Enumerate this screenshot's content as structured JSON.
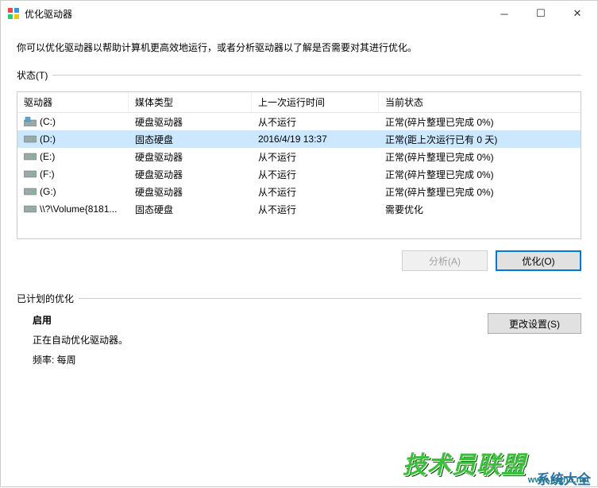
{
  "titlebar": {
    "title": "优化驱动器"
  },
  "description": "你可以优化驱动器以帮助计算机更高效地运行，或者分析驱动器以了解是否需要对其进行优化。",
  "status_label": "状态(T)",
  "table": {
    "headers": {
      "drive": "驱动器",
      "media": "媒体类型",
      "last": "上一次运行时间",
      "status": "当前状态"
    },
    "rows": [
      {
        "icon": "os",
        "name": "(C:)",
        "media": "硬盘驱动器",
        "last": "从不运行",
        "status": "正常(碎片整理已完成 0%)"
      },
      {
        "icon": "hdd",
        "name": "(D:)",
        "media": "固态硬盘",
        "last": "2016/4/19 13:37",
        "status": "正常(距上次运行已有 0 天)",
        "selected": true
      },
      {
        "icon": "hdd",
        "name": "(E:)",
        "media": "硬盘驱动器",
        "last": "从不运行",
        "status": "正常(碎片整理已完成 0%)"
      },
      {
        "icon": "hdd",
        "name": "(F:)",
        "media": "硬盘驱动器",
        "last": "从不运行",
        "status": "正常(碎片整理已完成 0%)"
      },
      {
        "icon": "hdd",
        "name": "(G:)",
        "media": "硬盘驱动器",
        "last": "从不运行",
        "status": "正常(碎片整理已完成 0%)"
      },
      {
        "icon": "hdd",
        "name": "\\\\?\\Volume{8181...",
        "media": "固态硬盘",
        "last": "从不运行",
        "status": "需要优化"
      }
    ]
  },
  "buttons": {
    "analyze": "分析(A)",
    "optimize": "优化(O)",
    "change_settings": "更改设置(S)"
  },
  "schedule": {
    "label": "已计划的优化",
    "enabled_title": "启用",
    "info1": "正在自动优化驱动器。",
    "info2": "频率: 每周"
  },
  "watermark": {
    "green": "技术员联盟",
    "url": "www.jsgho.net",
    "blue": "系统大全"
  }
}
